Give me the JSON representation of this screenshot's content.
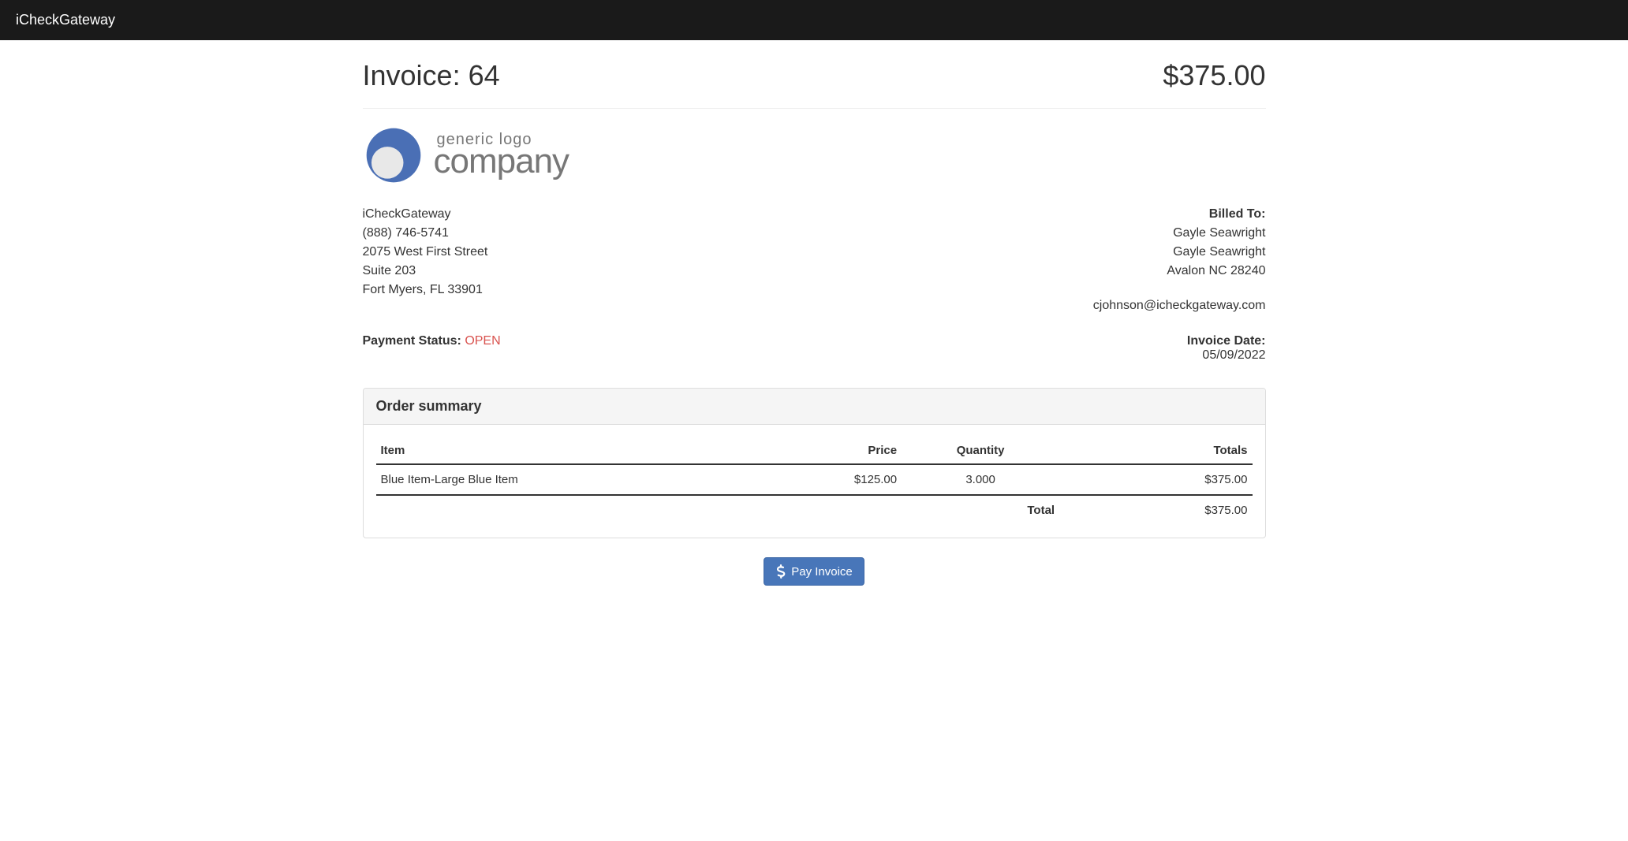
{
  "navbar": {
    "brand": "iCheckGateway"
  },
  "header": {
    "title": "Invoice: 64",
    "amount": "$375.00"
  },
  "logo": {
    "line1": "generic logo",
    "line2": "company"
  },
  "from": {
    "name": "iCheckGateway",
    "phone": "(888) 746-5741",
    "addr1": "2075 West First Street",
    "addr2": "Suite 203",
    "city": "Fort Myers, FL 33901"
  },
  "billed": {
    "label": "Billed To:",
    "name1": "Gayle Seawright",
    "name2": "Gayle Seawright",
    "city": "Avalon NC 28240",
    "email": "cjohnson@icheckgateway.com"
  },
  "status": {
    "label": "Payment Status: ",
    "value": "OPEN"
  },
  "invoice_date": {
    "label": "Invoice Date:",
    "value": "05/09/2022"
  },
  "summary": {
    "heading": "Order summary",
    "columns": {
      "item": "Item",
      "price": "Price",
      "quantity": "Quantity",
      "totals": "Totals"
    },
    "rows": [
      {
        "item": "Blue Item-Large Blue Item",
        "price": "$125.00",
        "quantity": "3.000",
        "total": "$375.00"
      }
    ],
    "total_label": "Total",
    "total_value": "$375.00"
  },
  "pay_button": {
    "label": "Pay Invoice"
  }
}
